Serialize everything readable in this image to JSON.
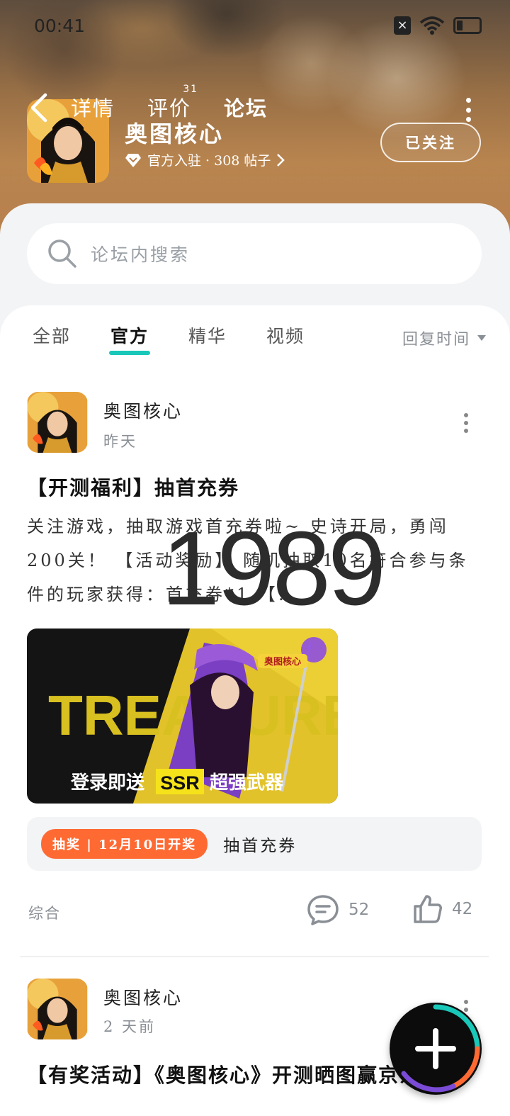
{
  "status_bar": {
    "time": "00:41",
    "sim_label": "×"
  },
  "header": {
    "tabs": [
      {
        "label": "详情",
        "count": ""
      },
      {
        "label": "评价",
        "count": "31"
      },
      {
        "label": "论坛",
        "count": ""
      }
    ],
    "active_tab": "论坛",
    "app_name": "奥图核心",
    "meta": "官方入驻 · 308 帖子",
    "follow_label": "已关注"
  },
  "search": {
    "placeholder": "论坛内搜索"
  },
  "filters": {
    "items": [
      "全部",
      "官方",
      "精华",
      "视频"
    ],
    "active": "官方",
    "sort_label": "回复时间"
  },
  "posts": [
    {
      "author": "奥图核心",
      "time": "昨天",
      "title": "【开测福利】抽首充券",
      "body": "关注游戏，抽取游戏首充券啦~ 史诗开局，勇闯200关！ 【活动奖励】 随机抽取10名符合参与条件的玩家获得：首充券*1 【…",
      "image": {
        "logo_text": "奥图核心",
        "headline": "TREASURE",
        "caption_prefix": "登录即送",
        "caption_highlight": "SSR",
        "caption_suffix": "超强武器"
      },
      "lottery": {
        "badge": "抽奖 | 12月10日开奖",
        "text": "抽首充券"
      },
      "tag": "综合",
      "comments": "52",
      "likes": "42"
    },
    {
      "author": "奥图核心",
      "time": "2 天前",
      "title": "【有奖活动】《奥图核心》开测晒图赢京东卡"
    }
  ],
  "overlay": {
    "watermark": "1989"
  },
  "colors": {
    "accent": "#19c8b9",
    "lottery": "#ff6a33"
  }
}
